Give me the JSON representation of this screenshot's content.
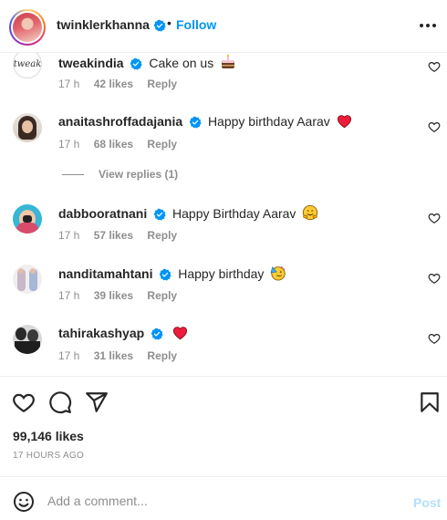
{
  "header": {
    "username": "twinklerkhanna",
    "separator": "•",
    "follow_label": "Follow"
  },
  "comments": [
    {
      "username": "tweakindia",
      "text": "Cake on us",
      "emoji": "cake",
      "time": "17 h",
      "likes": "42 likes",
      "reply": "Reply",
      "avatar_text": "tweak"
    },
    {
      "username": "anaitashroffadajania",
      "text": "Happy birthday Aarav",
      "emoji": "red-heart",
      "time": "17 h",
      "likes": "68 likes",
      "reply": "Reply"
    },
    {
      "username": "dabbooratnani",
      "text": "Happy Birthday Aarav",
      "emoji": "hugging-face",
      "time": "17 h",
      "likes": "57 likes",
      "reply": "Reply"
    },
    {
      "username": "nanditamahtani",
      "text": "Happy birthday",
      "emoji": "partying-face",
      "time": "17 h",
      "likes": "39 likes",
      "reply": "Reply"
    },
    {
      "username": "tahirakashyap",
      "text": "",
      "emoji": "red-heart",
      "time": "17 h",
      "likes": "31 likes",
      "reply": "Reply"
    }
  ],
  "view_replies_label": "View replies (1)",
  "actions": {
    "likes_count": "99,146 likes",
    "time_ago": "17 HOURS AGO"
  },
  "add_comment": {
    "placeholder": "Add a comment...",
    "post_label": "Post"
  },
  "colors": {
    "accent": "#0095f6",
    "post_disabled": "#b2dffc",
    "verified": "#0095f6",
    "heart_red": "#ed1c3a",
    "muted": "#8e8e8e"
  }
}
